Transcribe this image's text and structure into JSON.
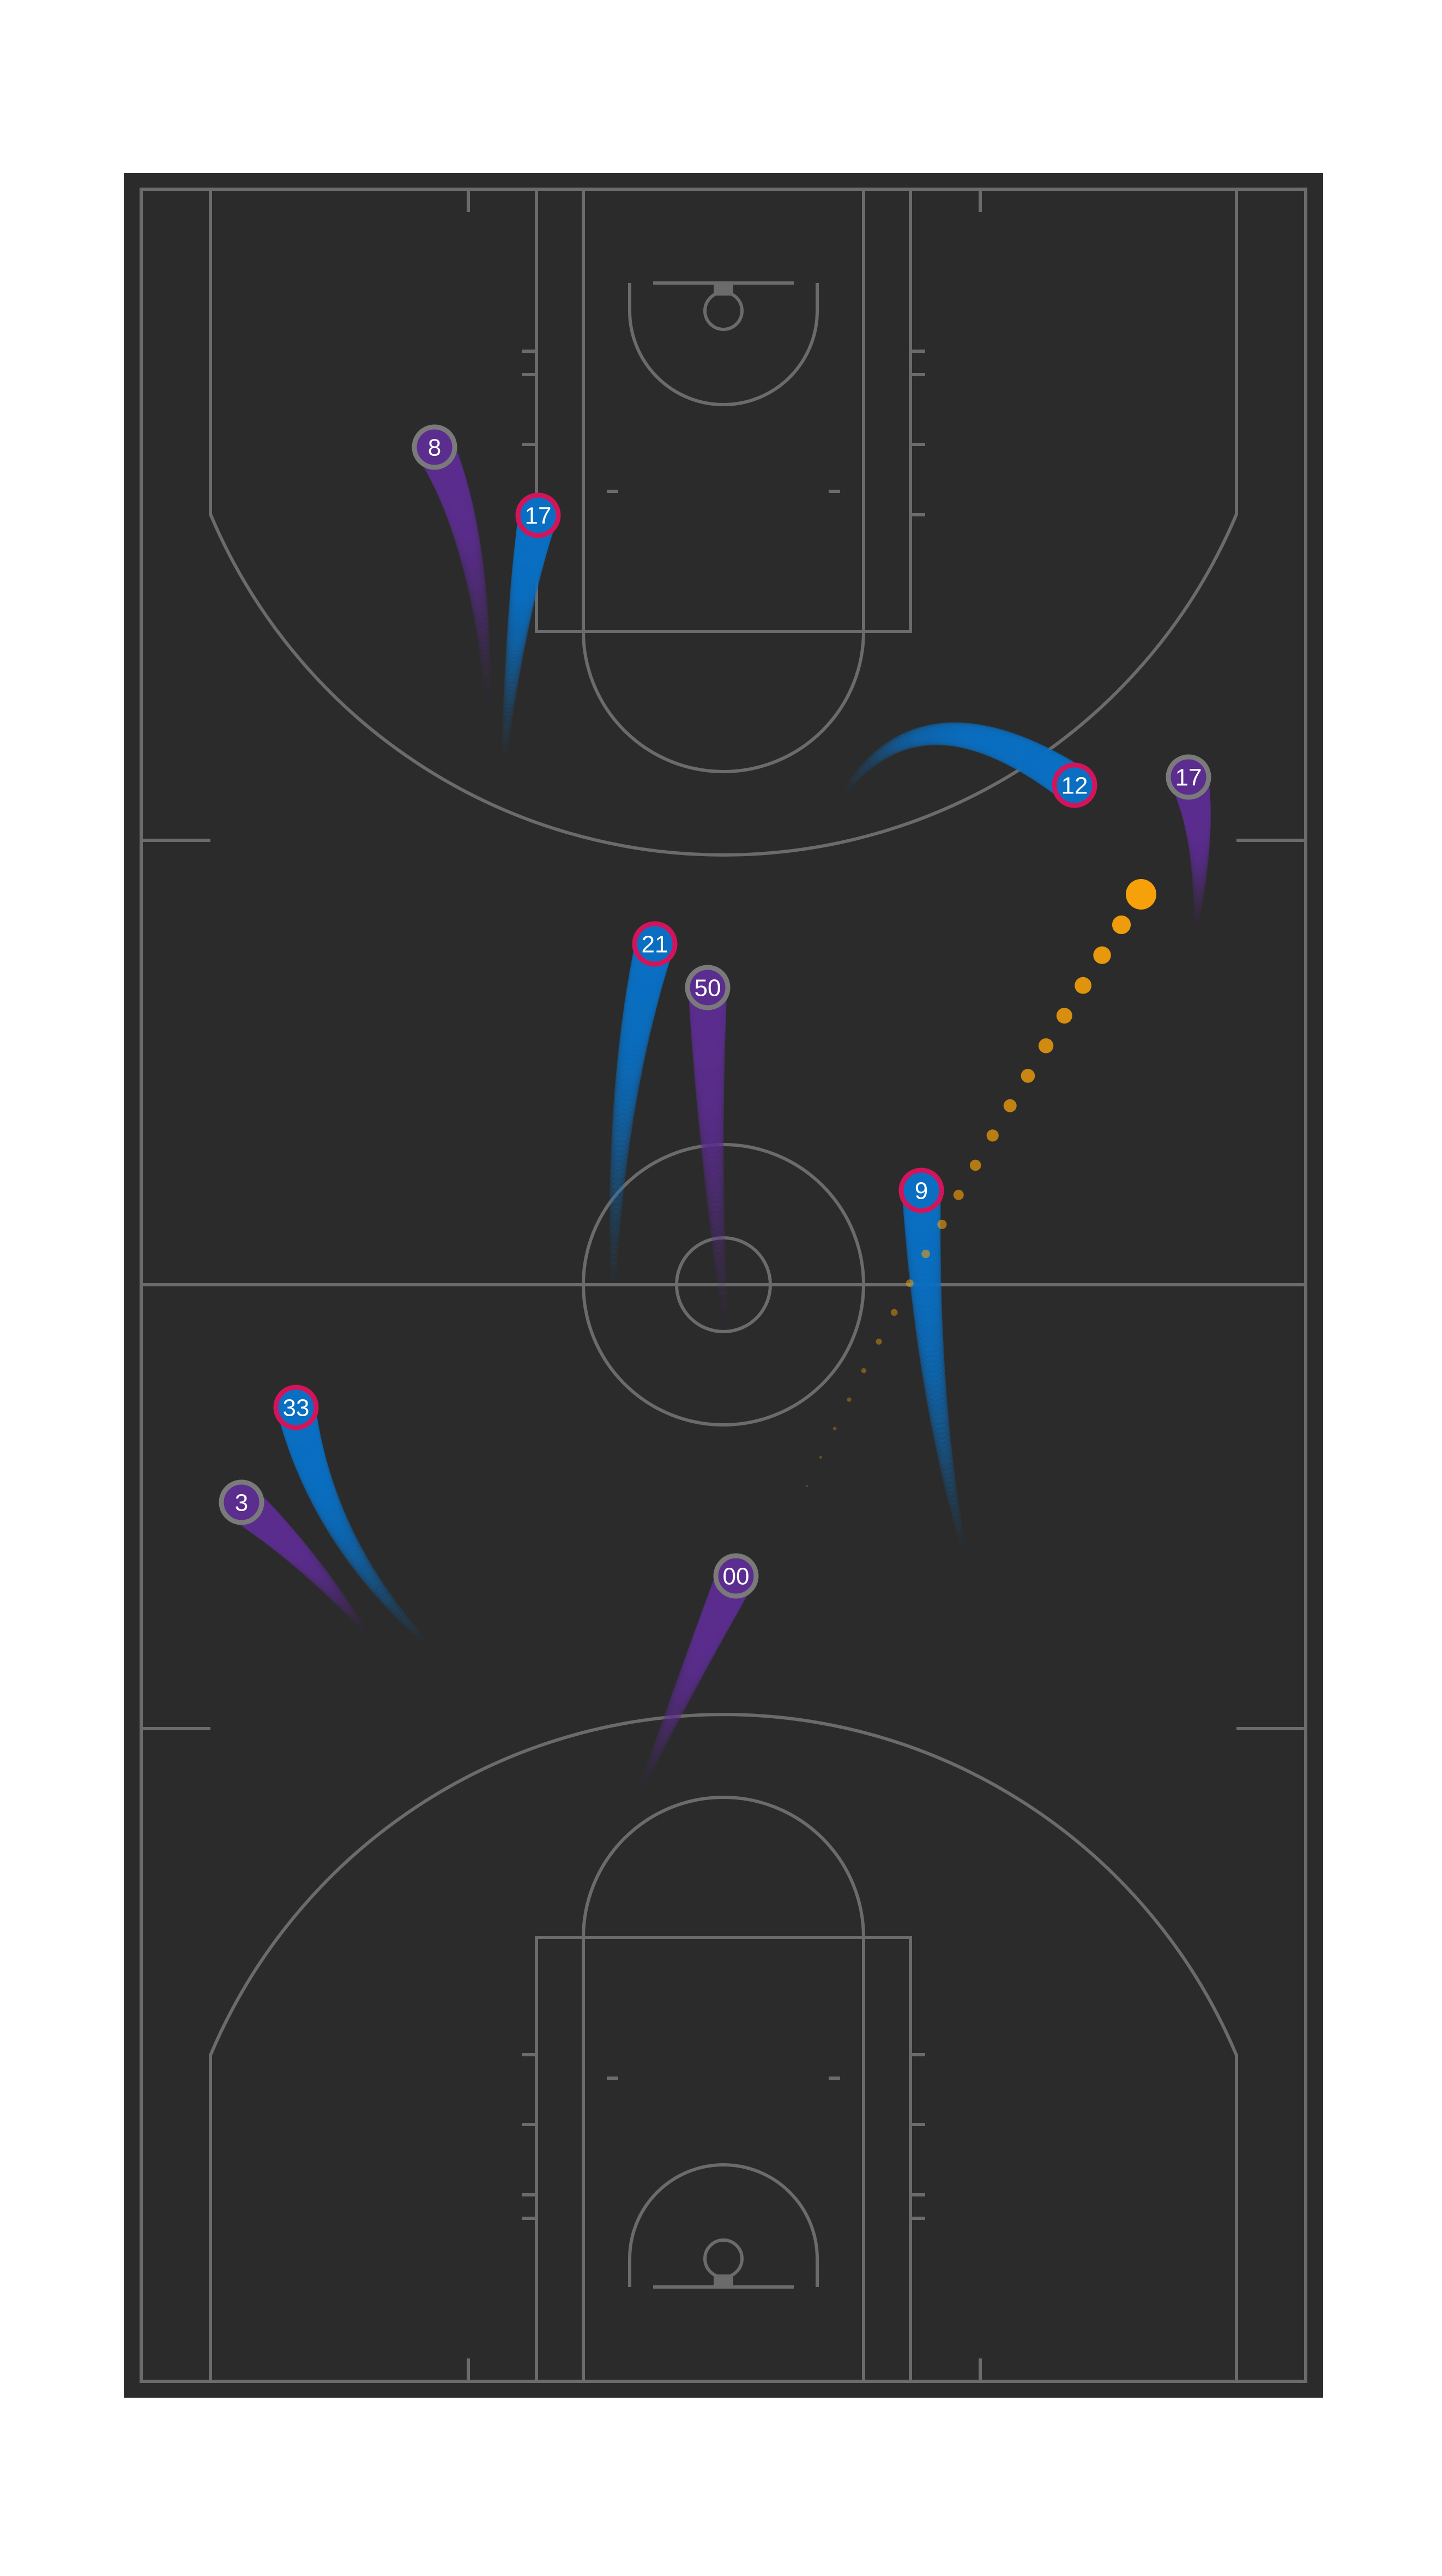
{
  "colors": {
    "background": "#ffffff",
    "court": "#2b2b2b",
    "lines": "#6b6b6b",
    "team_blue": "#0a6fc2",
    "team_blue_ring": "#d4145a",
    "team_purple": "#5b2d8e",
    "team_purple_ring": "#7a7a7a",
    "ball": "#f7a10a",
    "label": "#ffffff"
  },
  "players": [
    {
      "team": "purple",
      "number": "8"
    },
    {
      "team": "blue",
      "number": "17"
    },
    {
      "team": "blue",
      "number": "12"
    },
    {
      "team": "purple",
      "number": "17"
    },
    {
      "team": "blue",
      "number": "21"
    },
    {
      "team": "purple",
      "number": "50"
    },
    {
      "team": "blue",
      "number": "9"
    },
    {
      "team": "blue",
      "number": "33"
    },
    {
      "team": "purple",
      "number": "3"
    },
    {
      "team": "purple",
      "number": "00"
    }
  ],
  "icons": {
    "ball": "basketball-trail-icon"
  }
}
